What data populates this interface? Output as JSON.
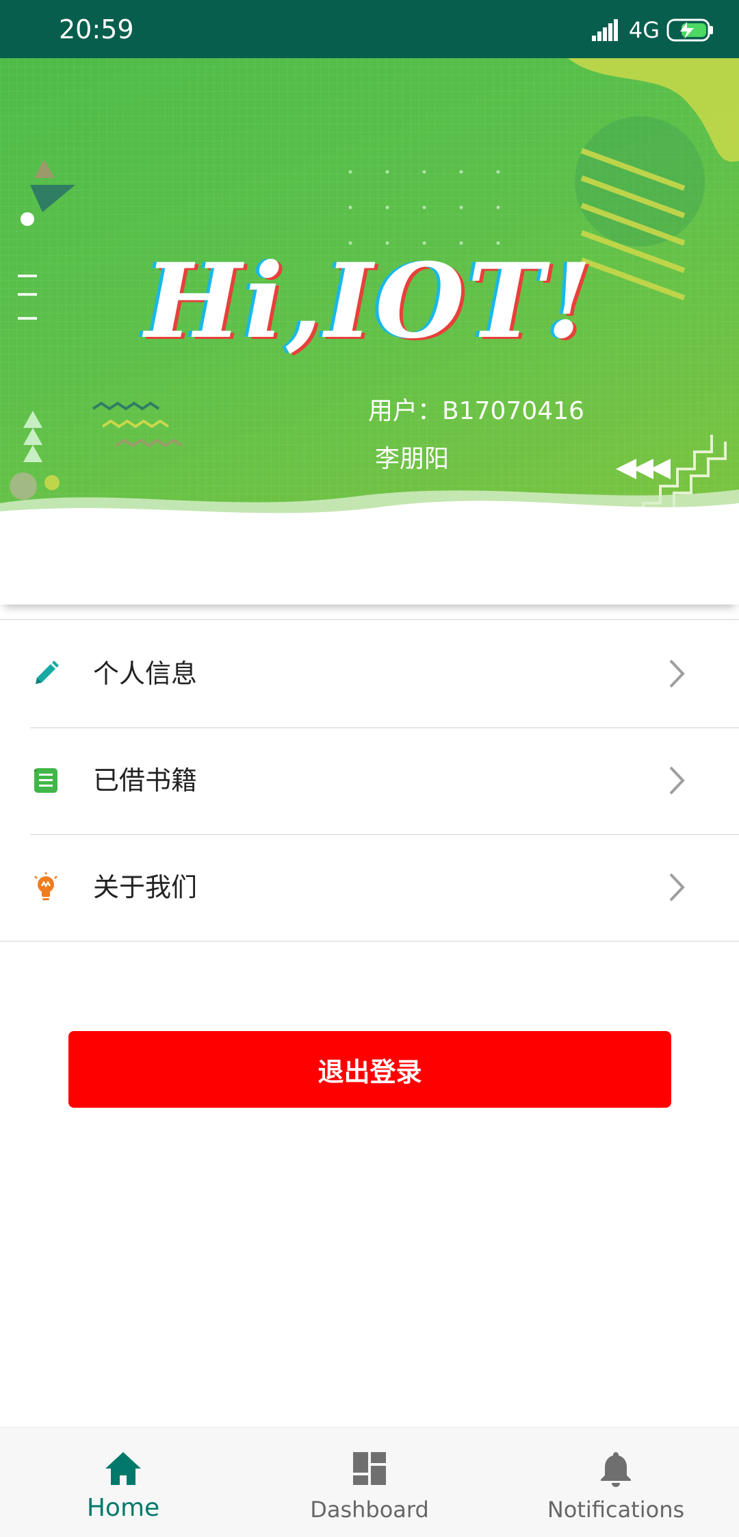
{
  "status_bar": {
    "time": "20:59",
    "network": "4G",
    "signal_icon": "signal-bars-icon",
    "battery_icon": "battery-charging-icon"
  },
  "banner": {
    "title": "Hi,IOT!",
    "user_id_line": "用户：B17070416",
    "user_name": "李朋阳"
  },
  "menu": {
    "items": [
      {
        "label": "个人信息",
        "icon": "pencil-icon",
        "color": "#17a9a3"
      },
      {
        "label": "已借书籍",
        "icon": "notebook-icon",
        "color": "#43b649"
      },
      {
        "label": "关于我们",
        "icon": "lightbulb-icon",
        "color": "#f07c1c"
      }
    ]
  },
  "logout": {
    "label": "退出登录",
    "color": "#ff0000"
  },
  "bottom_nav": {
    "items": [
      {
        "label": "Home",
        "icon": "home-icon",
        "active": true
      },
      {
        "label": "Dashboard",
        "icon": "dashboard-icon",
        "active": false
      },
      {
        "label": "Notifications",
        "icon": "bell-icon",
        "active": false
      }
    ],
    "active_color": "#00796b",
    "inactive_color": "#666666"
  },
  "colors": {
    "status_bar": "#075e4c",
    "banner_green": "#5cc04a"
  }
}
